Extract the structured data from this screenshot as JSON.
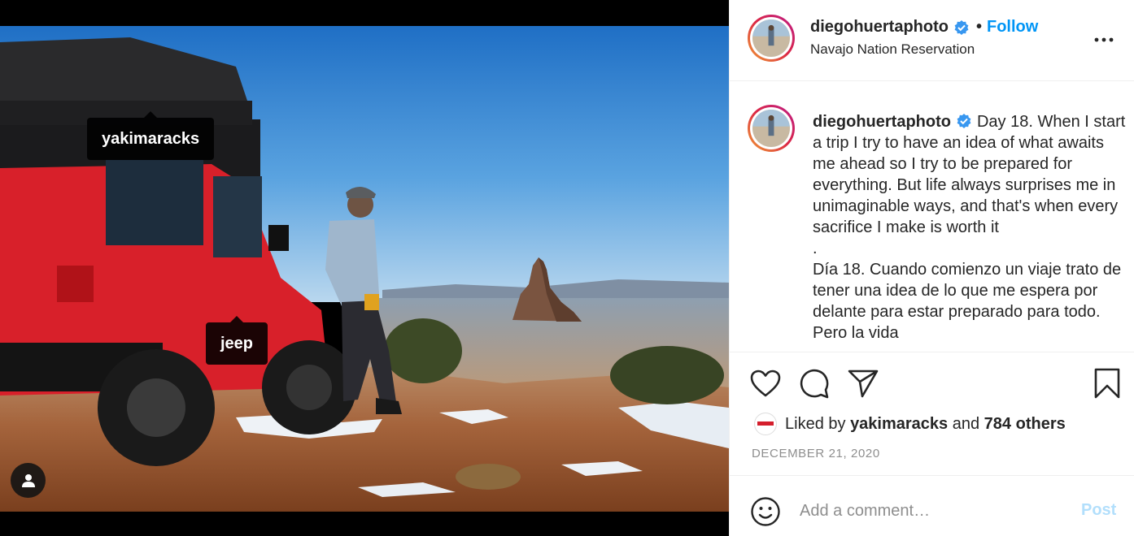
{
  "post": {
    "username": "diegohuertaphoto",
    "follow_label": "Follow",
    "dot": "•",
    "location": "Navajo Nation Reservation"
  },
  "photo_tags": [
    {
      "label": "yakimaracks"
    },
    {
      "label": "jeep"
    }
  ],
  "caption": {
    "username": "diegohuertaphoto",
    "lines": [
      "Day 18. When I start a trip I try to have an idea of what awaits me ahead so I try to be prepared for everything. But life always surprises me in unimaginable ways, and that's when every sacrifice I make is worth it",
      ".",
      "Día 18. Cuando comienzo un viaje trato de tener una idea de lo que me espera por delante para estar preparado para todo. Pero la vida"
    ]
  },
  "likes": {
    "prefix": "Liked by",
    "user": "yakimaracks",
    "middle": "and",
    "others": "784 others"
  },
  "date": "DECEMBER 21, 2020",
  "comment": {
    "placeholder": "Add a comment…",
    "post_label": "Post"
  },
  "icons": {
    "verified": "verified-badge-icon",
    "more": "more-options-icon",
    "like": "heart-icon",
    "comment": "comment-bubble-icon",
    "share": "paper-plane-icon",
    "save": "bookmark-icon",
    "emoji": "smiley-icon",
    "user_tags": "person-icon"
  },
  "colors": {
    "accent": "#0095f6",
    "verified": "#3897f0",
    "post_disabled": "#b2dffc",
    "secondary_text": "#8e8e8e",
    "divider": "#efefef"
  }
}
